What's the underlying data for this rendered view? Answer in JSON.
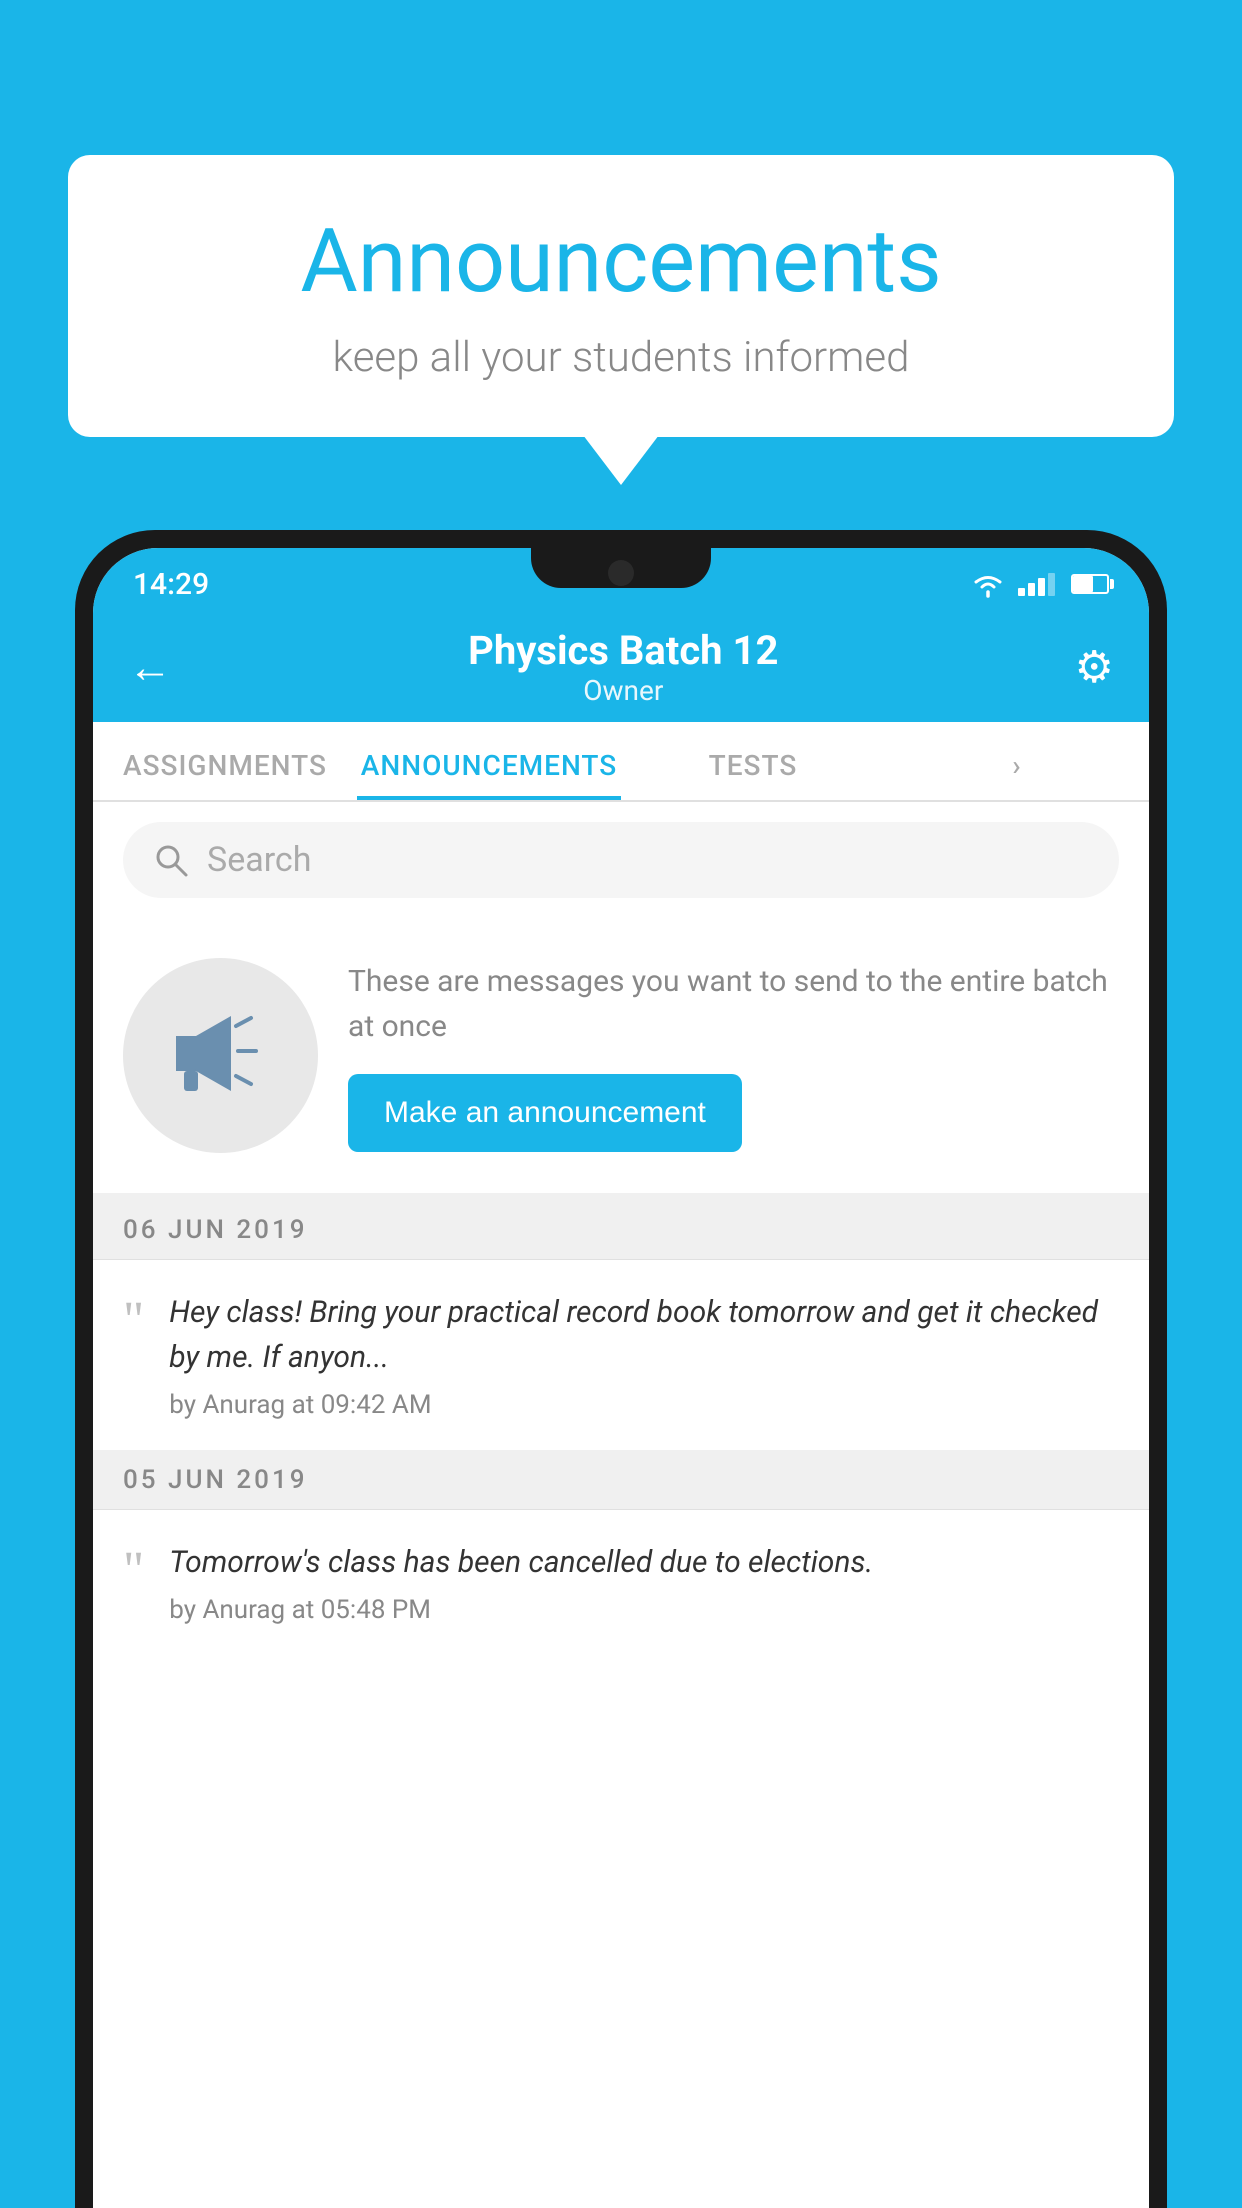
{
  "speech_bubble": {
    "title": "Announcements",
    "subtitle": "keep all your students informed"
  },
  "status_bar": {
    "time": "14:29"
  },
  "app_header": {
    "title": "Physics Batch 12",
    "subtitle": "Owner",
    "back_label": "←",
    "settings_label": "⚙"
  },
  "tabs": [
    {
      "label": "ASSIGNMENTS",
      "active": false
    },
    {
      "label": "ANNOUNCEMENTS",
      "active": true
    },
    {
      "label": "TESTS",
      "active": false
    },
    {
      "label": "...",
      "active": false
    }
  ],
  "search": {
    "placeholder": "Search"
  },
  "promo": {
    "description": "These are messages you want to send to the entire batch at once",
    "button_label": "Make an announcement"
  },
  "announcements": [
    {
      "date": "06  JUN  2019",
      "text": "Hey class! Bring your practical record book tomorrow and get it checked by me. If anyon...",
      "author": "by Anurag at 09:42 AM"
    },
    {
      "date": "05  JUN  2019",
      "text": "Tomorrow's class has been cancelled due to elections.",
      "author": "by Anurag at 05:48 PM"
    }
  ],
  "colors": {
    "accent": "#1ab5e8",
    "background": "#1ab5e8"
  }
}
